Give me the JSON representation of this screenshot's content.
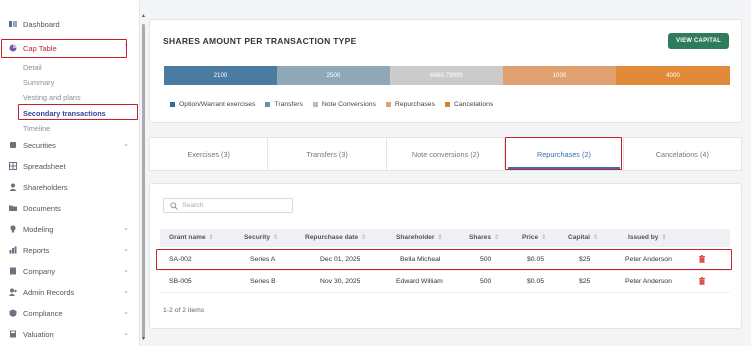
{
  "sidebar": {
    "items": [
      {
        "label": "Dashboard",
        "icon": "dashboard-icon",
        "chevron": ""
      },
      {
        "label": "Cap Table",
        "icon": "cap-table-icon",
        "chevron": "up"
      },
      {
        "label": "Securities",
        "icon": "securities-icon",
        "chevron": "down"
      },
      {
        "label": "Spreadsheet",
        "icon": "spreadsheet-icon",
        "chevron": ""
      },
      {
        "label": "Shareholders",
        "icon": "shareholders-icon",
        "chevron": ""
      },
      {
        "label": "Documents",
        "icon": "documents-icon",
        "chevron": ""
      },
      {
        "label": "Modeling",
        "icon": "modeling-icon",
        "chevron": "down"
      },
      {
        "label": "Reports",
        "icon": "reports-icon",
        "chevron": "down"
      },
      {
        "label": "Company",
        "icon": "company-icon",
        "chevron": "down"
      },
      {
        "label": "Admin Records",
        "icon": "admin-records-icon",
        "chevron": "down"
      },
      {
        "label": "Compliance",
        "icon": "compliance-icon",
        "chevron": "down"
      },
      {
        "label": "Valuation",
        "icon": "valuation-icon",
        "chevron": "down"
      }
    ],
    "cap_table_sub": [
      "Detail",
      "Summary",
      "Vesting and plans",
      "Secondary transactions",
      "Timeline"
    ]
  },
  "header": {
    "title": "SHARES AMOUNT PER TRANSACTION TYPE",
    "view_button": "VIEW CAPITAL"
  },
  "bar_segments": [
    {
      "value": "2100",
      "color": "#4a7ba3"
    },
    {
      "value": "2500",
      "color": "#8fa8b8"
    },
    {
      "value": "6668.79999",
      "color": "#cbcbcb"
    },
    {
      "value": "1000",
      "color": "#e0a070"
    },
    {
      "value": "4000",
      "color": "#e08a3a"
    }
  ],
  "legend": [
    {
      "label": "Option/Warrant exercises",
      "color": "#2f6d96"
    },
    {
      "label": "Transfers",
      "color": "#6f8ea3"
    },
    {
      "label": "Note Conversions",
      "color": "#bdbdbd"
    },
    {
      "label": "Repurchases",
      "color": "#e0a070"
    },
    {
      "label": "Cancelations",
      "color": "#d9822b"
    }
  ],
  "tabs": [
    "Exercises (3)",
    "Transfers (3)",
    "Note conversions (2)",
    "Repurchases (2)",
    "Cancelations (4)"
  ],
  "active_tab": "Repurchases (2)",
  "search": {
    "placeholder": "Search"
  },
  "table": {
    "columns": [
      "Grant name",
      "Security",
      "Repurchase date",
      "Shareholder",
      "Shares",
      "Price",
      "Capital",
      "Issued by"
    ],
    "rows": [
      [
        "SA-002",
        "Series A",
        "Dec 01, 2025",
        "Bella Micheal",
        "500",
        "$0.05",
        "$25",
        "Peter Anderson"
      ],
      [
        "SB-005",
        "Series B",
        "Nov 30, 2025",
        "Edward William",
        "500",
        "$0.05",
        "$25",
        "Peter Anderson"
      ]
    ]
  },
  "pagination": "1-2 of 2 items"
}
